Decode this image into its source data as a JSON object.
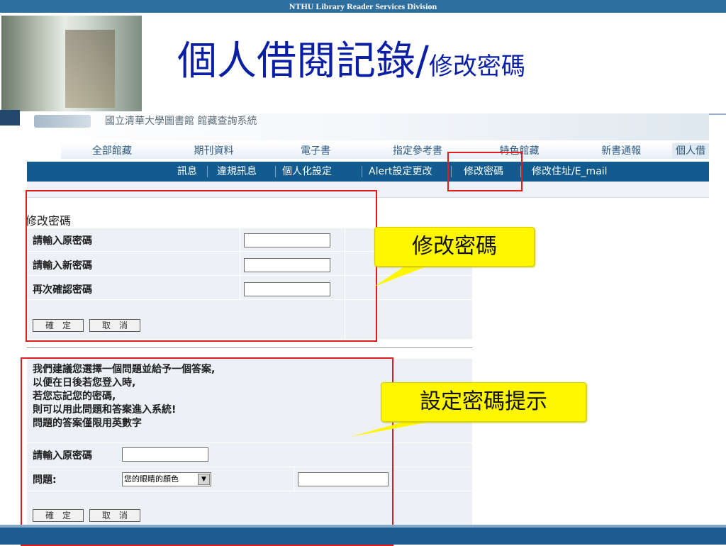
{
  "slide": {
    "header_bar": "NTHU Library Reader Services Division",
    "title_main": "個人借閱記錄/",
    "title_sub": "修改密碼"
  },
  "webpage": {
    "banner_text": "國立清華大學圖書館 館藏查詢系統",
    "nav_primary": [
      "全部館藏",
      "期刊資料",
      "電子書",
      "指定參考書",
      "特色館藏",
      "新書通報",
      "個人借"
    ],
    "nav_secondary": [
      "訊息",
      "違規訊息",
      "個人化設定",
      "Alert設定更改",
      "修改密碼",
      "修改住址/E_mail"
    ],
    "change_password_form": {
      "title": "修改密碼",
      "fields": [
        {
          "label": "請輸入原密碼",
          "value": ""
        },
        {
          "label": "請輸入新密碼",
          "value": ""
        },
        {
          "label": "再次確認密碼",
          "value": ""
        }
      ],
      "buttons": {
        "confirm": "確　定",
        "cancel": "取　消"
      }
    },
    "password_hint_form": {
      "instruction_lines": [
        "我們建議您選擇一個問題並給予一個答案,",
        "以便在日後若您登入時,",
        "若您忘記您的密碼,",
        "則可以用此問題和答案進入系統!",
        "問題的答案僅限用英數字"
      ],
      "password_label": "請輸入原密碼",
      "question_label": "問題:",
      "question_selected": "您的眼睛的顏色",
      "answer_value": "",
      "buttons": {
        "confirm": "確　定",
        "cancel": "取　消"
      }
    }
  },
  "callouts": {
    "change_password": "修改密碼",
    "set_password_hint": "設定密碼提示"
  },
  "colors": {
    "title_blue": "#0b1fa4",
    "nav_blue": "#125b8f",
    "highlight_red": "#df1d1d",
    "callout_yellow": "#fff600",
    "form_background": "#edf1f6"
  }
}
